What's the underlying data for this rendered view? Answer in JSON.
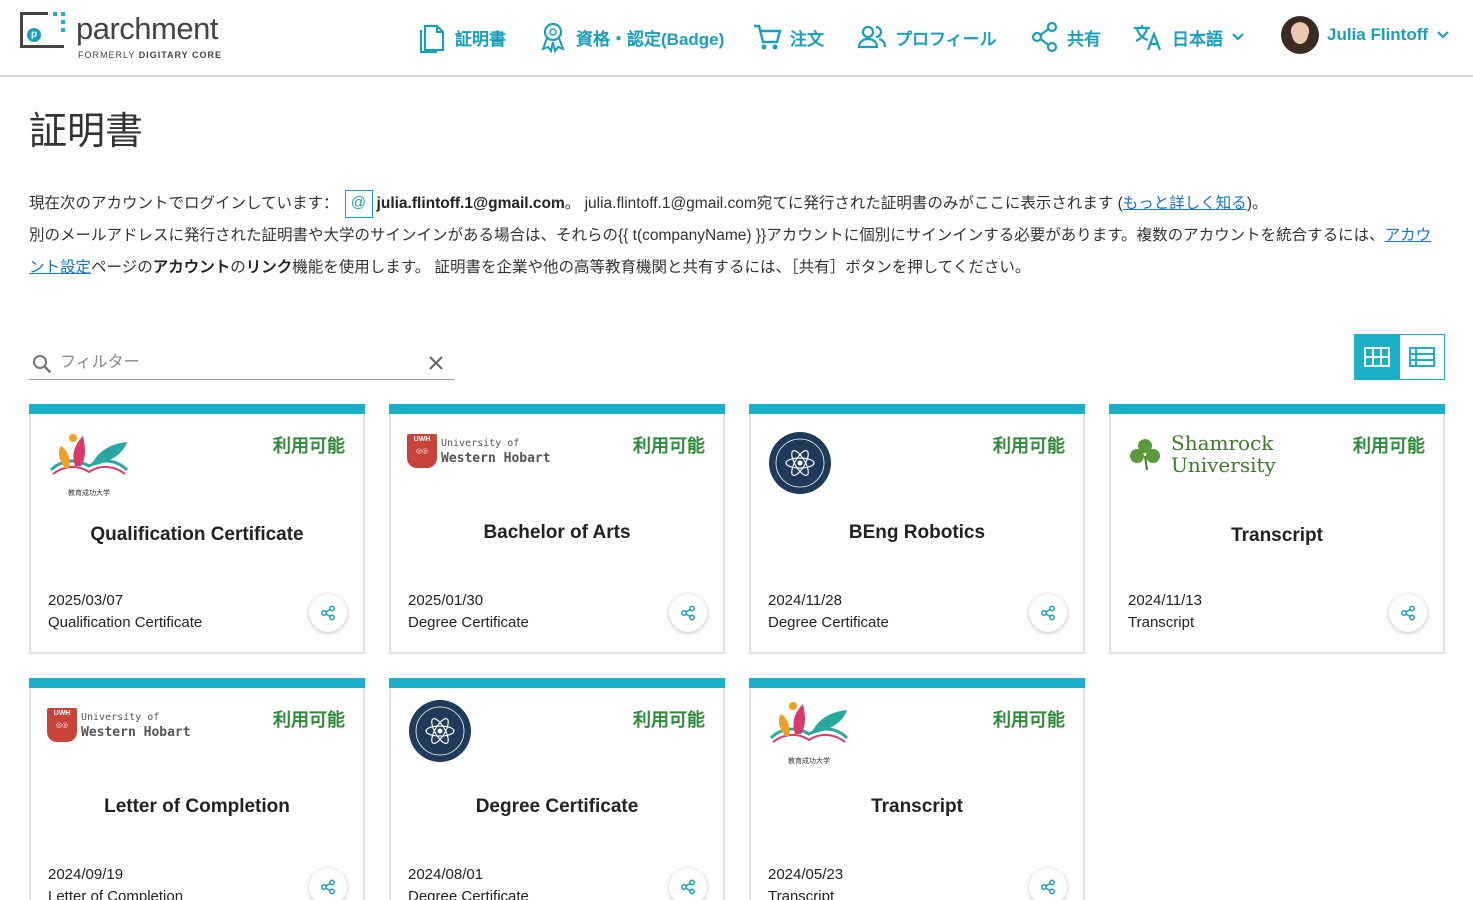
{
  "header": {
    "logo_name": "parchment",
    "logo_sub_prefix": "FORMERLY ",
    "logo_sub_bold": "DIGITARY CORE",
    "nav": {
      "certificates": "証明書",
      "badges": "資格・認定(Badge)",
      "orders": "注文",
      "profile": "プロフィール",
      "share": "共有",
      "language": "日本語",
      "user": "Julia Flintoff"
    }
  },
  "page": {
    "title": "証明書",
    "info": {
      "line1_prefix": "現在次のアカウントでログインしています：",
      "email_icon": "@",
      "email": "julia.flintoff.1@gmail.com",
      "line1_mid": "。 julia.flintoff.1@gmail.com宛てに発行された証明書のみがここに表示されます (",
      "learn_more": "もっと詳しく知る",
      "line1_suffix": ")。",
      "line2_prefix": "別のメールアドレスに発行された証明書や大学のサインインがある場合は、それらの{{ t(companyName) }}アカウントに個別にサインインする必要があります。複数のアカウントを統合するには、",
      "account_settings": "アカウント設定",
      "line2_mid1": "ページの",
      "account_bold": "アカウント",
      "line2_mid2": "の",
      "link_bold": "リンク",
      "line2_suffix": "機能を使用します。 証明書を企業や他の高等教育機関と共有するには、［共有］ボタンを押してください。"
    },
    "filter_placeholder": "フィルター",
    "filter_value": ""
  },
  "logos": {
    "uwh_badge": "UWH",
    "uwh_line1": "University of",
    "uwh_line2": "Western Hobart",
    "shamrock_line1": "Shamrock",
    "shamrock_line2": "University",
    "edu_caption": "教育成功大学"
  },
  "cards": [
    {
      "status": "利用可能",
      "title": "Qualification Certificate",
      "date": "2025/03/07",
      "type": "Qualification Certificate",
      "logo": "edu-success"
    },
    {
      "status": "利用可能",
      "title": "Bachelor of Arts",
      "date": "2025/01/30",
      "type": "Degree Certificate",
      "logo": "western-hobart"
    },
    {
      "status": "利用可能",
      "title": "BEng Robotics",
      "date": "2024/11/28",
      "type": "Degree Certificate",
      "logo": "science-seal"
    },
    {
      "status": "利用可能",
      "title": "Transcript",
      "date": "2024/11/13",
      "type": "Transcript",
      "logo": "shamrock"
    },
    {
      "status": "利用可能",
      "title": "Letter of Completion",
      "date": "2024/09/19",
      "type": "Letter of Completion",
      "logo": "western-hobart"
    },
    {
      "status": "利用可能",
      "title": "Degree Certificate",
      "date": "2024/08/01",
      "type": "Degree Certificate",
      "logo": "science-seal"
    },
    {
      "status": "利用可能",
      "title": "Transcript",
      "date": "2024/05/23",
      "type": "Transcript",
      "logo": "edu-success"
    }
  ],
  "colors": {
    "accent": "#1ab0c8",
    "status_green": "#2e8b3a",
    "link": "#1a73c8"
  }
}
